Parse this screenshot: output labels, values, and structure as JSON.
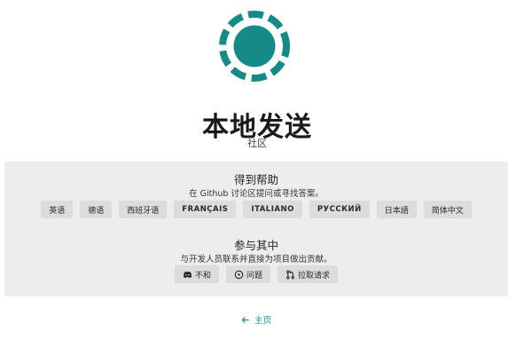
{
  "app": {
    "title": "本地发送",
    "subtitle": "社区",
    "accent_color": "#168a87"
  },
  "help": {
    "title": "得到帮助",
    "description": "在 Github 讨论区提问或寻找答案。",
    "languages": [
      {
        "label": "英语"
      },
      {
        "label": "德语"
      },
      {
        "label": "西班牙语"
      },
      {
        "label": "FRANÇAIS"
      },
      {
        "label": "ITALIANO"
      },
      {
        "label": "РУССКИЙ"
      },
      {
        "label": "日本語"
      },
      {
        "label": "简体中文"
      }
    ]
  },
  "contribute": {
    "title": "参与其中",
    "description": "与开发人员联系并直接为项目做出贡献。",
    "buttons": [
      {
        "label": "不和",
        "icon": "discord-icon"
      },
      {
        "label": "问题",
        "icon": "issue-icon"
      },
      {
        "label": "拉取请求",
        "icon": "pull-request-icon"
      }
    ]
  },
  "nav": {
    "back_label": "主页",
    "back_icon": "arrow-left-icon"
  }
}
